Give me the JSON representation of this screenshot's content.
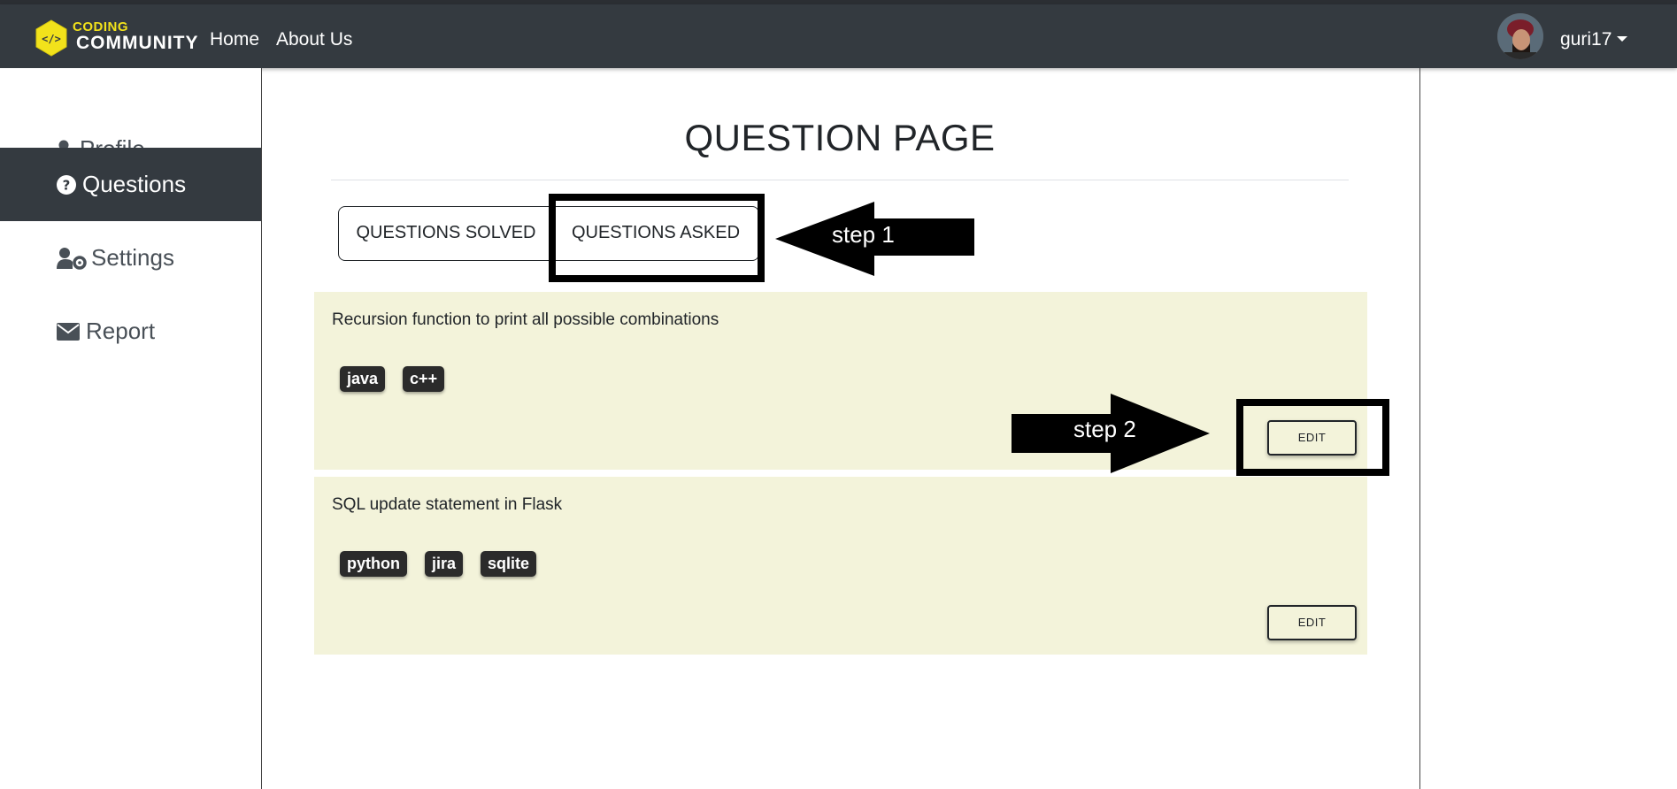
{
  "navbar": {
    "logo_top": "CODING",
    "logo_bottom": "COMMUNITY",
    "logo_code_glyph": "</>",
    "links": [
      {
        "label": "Home"
      },
      {
        "label": "About Us"
      }
    ],
    "user": {
      "name": "guri17"
    }
  },
  "sidebar": {
    "items": [
      {
        "label": "Profile",
        "icon": "user-icon",
        "active": false
      },
      {
        "label": "Questions",
        "icon": "question-circle-icon",
        "active": true
      },
      {
        "label": "Settings",
        "icon": "user-cog-icon",
        "active": false
      },
      {
        "label": "Report",
        "icon": "envelope-icon",
        "active": false
      }
    ]
  },
  "main": {
    "title": "QUESTION PAGE",
    "tabs": [
      {
        "label": "QUESTIONS SOLVED"
      },
      {
        "label": "QUESTIONS ASKED"
      }
    ],
    "questions": [
      {
        "title": "Recursion function to print all possible combinations",
        "tags": [
          "java",
          "c++"
        ],
        "edit_label": "EDIT"
      },
      {
        "title": "SQL update statement in Flask",
        "tags": [
          "python",
          "jira",
          "sqlite"
        ],
        "edit_label": "EDIT"
      }
    ]
  },
  "annotations": {
    "step1": "step 1",
    "step2": "step 2"
  },
  "colors": {
    "navbar": "#343a40",
    "accent_yellow": "#f2e21b",
    "card_bg": "#f3f3da",
    "tag_bg": "#2b2b2b"
  }
}
